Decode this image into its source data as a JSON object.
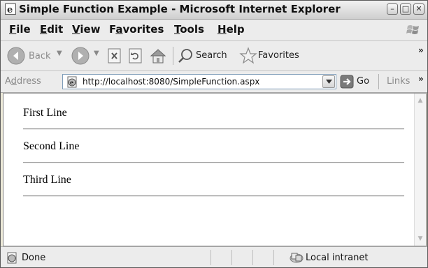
{
  "window": {
    "title": "Simple Function Example - Microsoft Internet Explorer"
  },
  "menu": {
    "items": [
      {
        "label": "File",
        "accel": "F",
        "rest": "ile"
      },
      {
        "label": "Edit",
        "accel": "E",
        "rest": "dit"
      },
      {
        "label": "View",
        "accel": "V",
        "rest": "iew"
      },
      {
        "label": "Favorites",
        "pre": "F",
        "accel": "a",
        "rest": "vorites"
      },
      {
        "label": "Tools",
        "accel": "T",
        "rest": "ools"
      },
      {
        "label": "Help",
        "accel": "H",
        "rest": "elp"
      }
    ]
  },
  "toolbar": {
    "back_label": "Back",
    "search_label": "Search",
    "favorites_label": "Favorites",
    "overflow": "»"
  },
  "address_bar": {
    "label": "Address",
    "label_accel": "d",
    "url": "http://localhost:8080/SimpleFunction.aspx",
    "go_label": "Go",
    "links_label": "Links",
    "overflow": "»"
  },
  "page": {
    "lines": [
      "First Line",
      "Second Line",
      "Third Line"
    ]
  },
  "status": {
    "text": "Done",
    "zone": "Local intranet"
  },
  "colors": {
    "go_arrow": "#3a9a3a",
    "nav_gray": "#8c8c8c",
    "star": "#c8a000"
  },
  "icons": [
    "ie-icon",
    "back-icon",
    "forward-icon",
    "stop-icon",
    "refresh-icon",
    "home-icon",
    "search-icon",
    "favorites-star-icon",
    "page-icon",
    "go-arrow-icon",
    "windows-logo-icon",
    "intranet-icon"
  ]
}
